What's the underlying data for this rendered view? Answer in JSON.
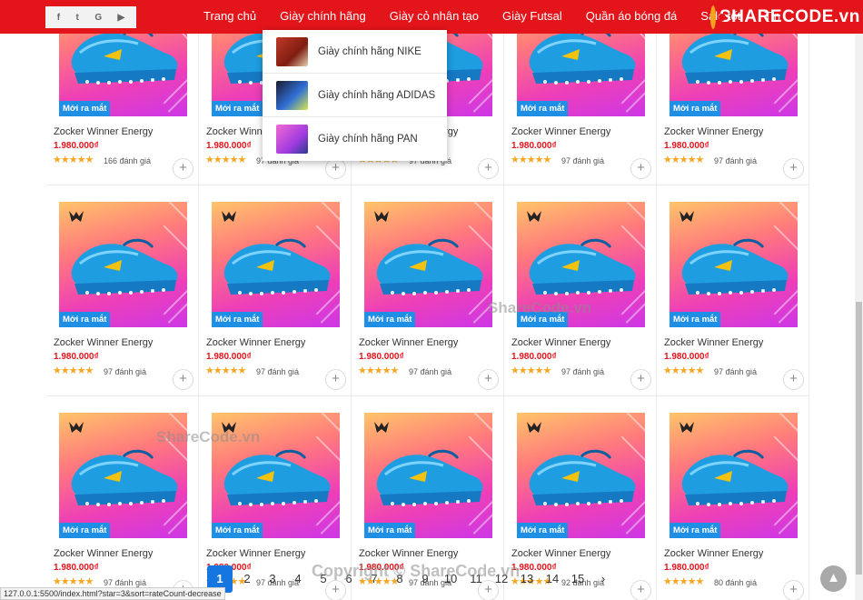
{
  "social_icons": [
    "facebook-icon",
    "twitter-icon",
    "google-icon",
    "youtube-icon"
  ],
  "nav": {
    "items": [
      "Trang chủ",
      "Giày chính hãng",
      "Giày cỏ nhân tạo",
      "Giày Futsal",
      "Quần áo bóng đá",
      "Sale tốt",
      "Tin"
    ]
  },
  "logo": {
    "text": "SHARECODE.vn"
  },
  "dropdown": {
    "items": [
      "Giày chính hãng NIKE",
      "Giày chính hãng ADIDAS",
      "Giày chính hãng PAN"
    ]
  },
  "product_defaults": {
    "name": "Zocker Winner Energy",
    "price": "1.980.000₫",
    "badge": "Mới ra mắt",
    "stars": "★★★★★"
  },
  "products": [
    {
      "reviews": "166 đánh giá"
    },
    {
      "reviews": "97 đánh giá"
    },
    {
      "reviews": "97 đánh giá"
    },
    {
      "reviews": "97 đánh giá"
    },
    {
      "reviews": "97 đánh giá"
    },
    {
      "reviews": "97 đánh giá"
    },
    {
      "reviews": "97 đánh giá"
    },
    {
      "reviews": "97 đánh giá"
    },
    {
      "reviews": "97 đánh giá"
    },
    {
      "reviews": "97 đánh giá"
    },
    {
      "reviews": "97 đánh giá"
    },
    {
      "reviews": "97 đánh giá"
    },
    {
      "reviews": "97 đánh giá"
    },
    {
      "reviews": "92 đánh giá"
    },
    {
      "reviews": "80 đánh giá"
    }
  ],
  "pagination": {
    "pages": [
      "1",
      "2",
      "3",
      "4",
      "5",
      "6",
      "7",
      "8",
      "9",
      "10",
      "11",
      "12",
      "13",
      "14",
      "15"
    ],
    "active": "1",
    "next": "›"
  },
  "status_url": "127.0.0.1:5500/index.html?star=3&sort=rateCount-decrease",
  "watermarks": [
    "ShareCode.vn",
    "ShareCode.vn",
    "Copyright © ShareCode.vn"
  ],
  "colors": {
    "brand_red": "#e4141b",
    "badge_blue": "#1f8fe6",
    "active_page": "#1576e1",
    "star": "#f5a623"
  }
}
